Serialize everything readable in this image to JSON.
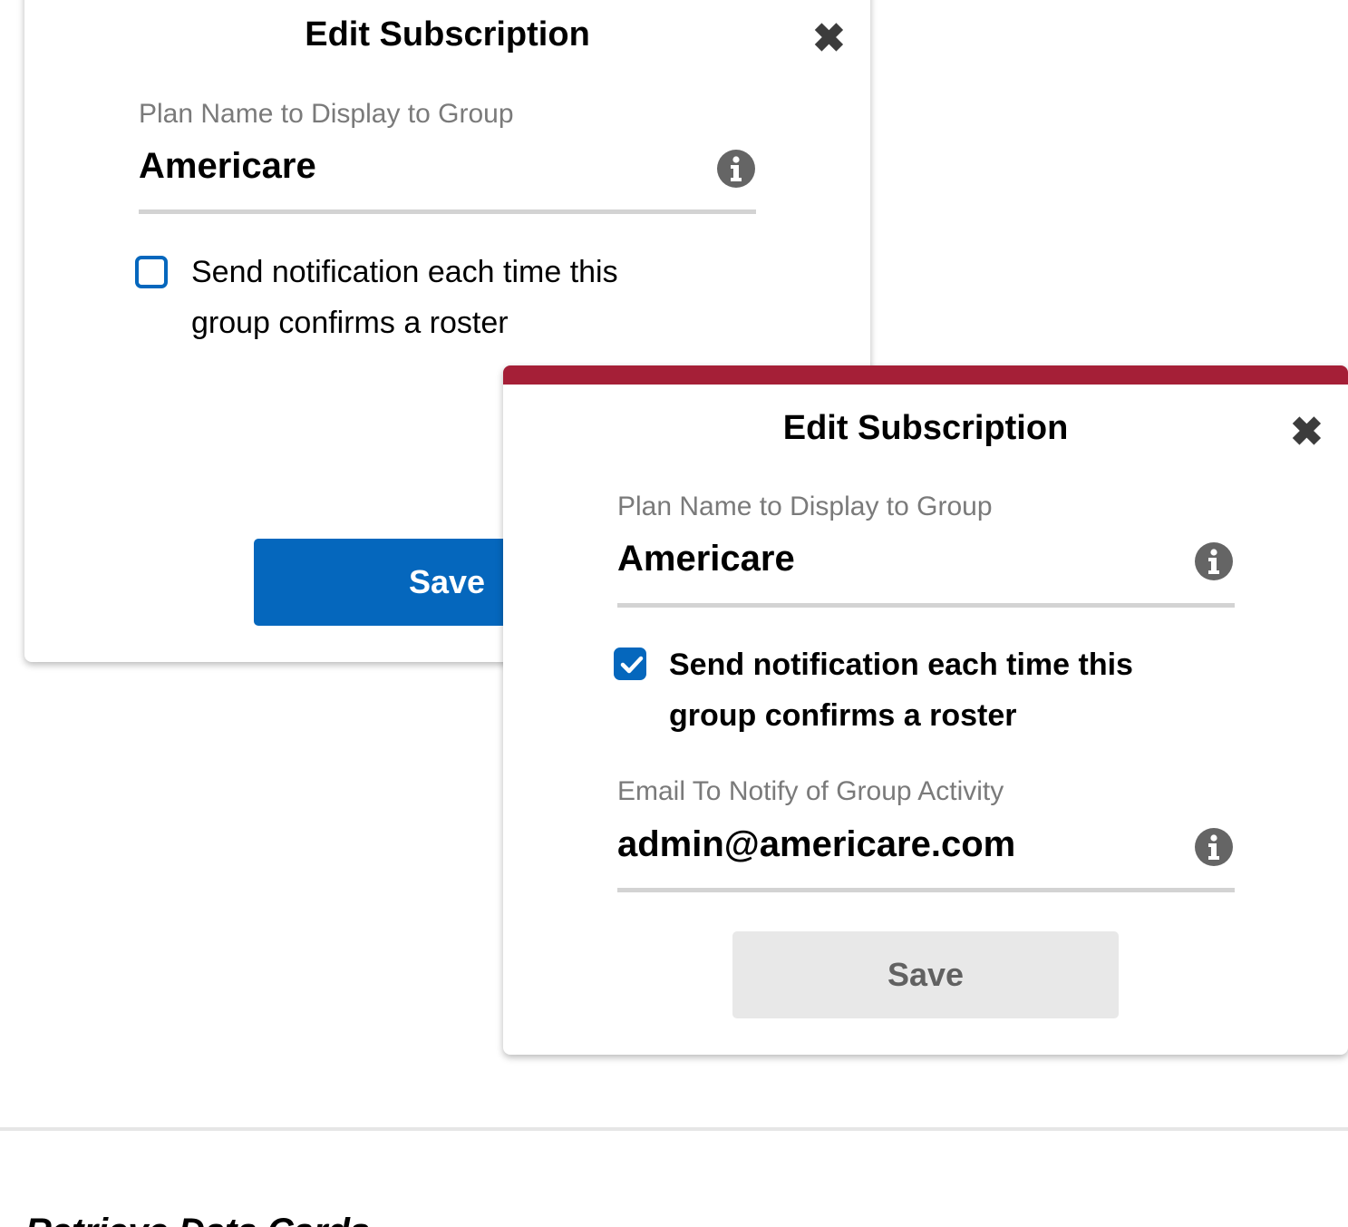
{
  "back_modal": {
    "title": "Edit Subscription",
    "close_icon": "close-icon",
    "plan_label": "Plan Name to Display to Group",
    "plan_value": "Americare",
    "notify_checked": false,
    "notify_text": "Send notification each time this group confirms a roster",
    "save_label": "Save"
  },
  "front_modal": {
    "title": "Edit Subscription",
    "close_icon": "close-icon",
    "plan_label": "Plan Name to Display to Group",
    "plan_value": "Americare",
    "notify_checked": true,
    "notify_text": "Send notification each time this group confirms a roster",
    "email_label": "Email To Notify of Group Activity",
    "email_value": "admin@americare.com",
    "save_label": "Save",
    "save_disabled": true
  },
  "footer": {
    "section_heading": "Retrieve Data Cards"
  },
  "colors": {
    "primary_blue": "#0567bd",
    "accent_red": "#a51f37",
    "disabled_gray": "#e8e8e8"
  }
}
